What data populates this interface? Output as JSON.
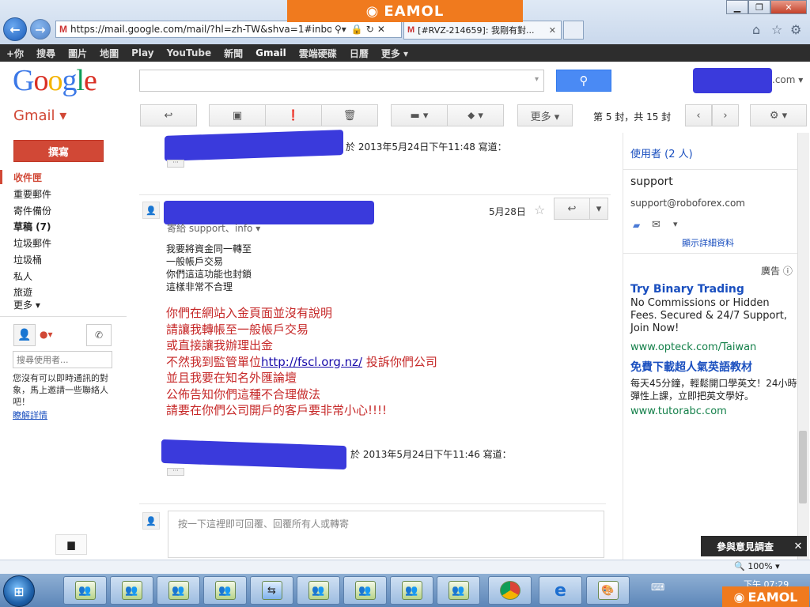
{
  "browser": {
    "url": "https://mail.google.com/mail/?hl=zh-TW&shva=1#inbox",
    "tab2_title": "[#RVZ-214659]: 我剛有對...",
    "watermark": "EAMOL",
    "zoom": "100%",
    "clock": "下午 07:29"
  },
  "gbar": [
    "+你",
    "搜尋",
    "圖片",
    "地圖",
    "Play",
    "YouTube",
    "新聞",
    "Gmail",
    "雲端硬碟",
    "日曆",
    "更多 ▾"
  ],
  "header": {
    "user_suffix": ".com ▾"
  },
  "toolbar": {
    "gmail_label": "Gmail ▾",
    "more_label": "更多 ▾",
    "page_info": "第 5 封，共 15 封"
  },
  "sidebar": {
    "compose": "撰寫",
    "items": [
      "收件匣",
      "重要郵件",
      "寄件備份",
      "草稿 (7)",
      "垃圾郵件",
      "垃圾桶",
      "私人",
      "旅遊",
      "更多 ▾"
    ],
    "chat_search_placeholder": "搜尋使用者...",
    "chat_empty": "您沒有可以即時通訊的對象，馬上邀請一些聯絡人吧！",
    "learn_more": "瞭解詳情"
  },
  "thread": {
    "quote1_date": "於 2013年5月24日下午11:48 寫道：",
    "msg_date": "5月28日",
    "msg_to": "寄給 support、info ▾",
    "small_lines": [
      "我要將資金同一轉至",
      "一般帳戶交易",
      "你們這這功能也封鎖",
      "這樣非常不合理"
    ],
    "red_lines": [
      "你們在網站入金頁面並沒有說明",
      "請讓我轉帳至一般帳戶交易",
      "或直接讓我辦理出金",
      "不然我到監管單位",
      "並且我要在知名外匯論壇",
      "公佈告知你們這種不合理做法",
      "請要在你們公司開戶的客戶要非常小心!!!!"
    ],
    "link": "http://fscl.org.nz/",
    "after_link": " 投訴你們公司",
    "quote2_date": "於 2013年5月24日下午11:46 寫道：",
    "reply_placeholder": "按一下這裡即可回覆、回覆所有人或轉寄"
  },
  "right": {
    "people": "使用者 (2 人)",
    "contact_name": "support",
    "contact_email": "support@roboforex.com",
    "show_details": "顯示詳細資料",
    "ads_label": "廣告 ⓘ",
    "ad1": {
      "title": "Try Binary Trading",
      "text": "No Commissions or Hidden Fees. Secured & 24/7 Support, Join Now!",
      "url": "www.opteck.com/Taiwan"
    },
    "ad2": {
      "title": "免費下載超人氣英語教材",
      "text": "每天45分鐘，輕鬆開口學英文！24小時彈性上課，立即把英文學好。",
      "url": "www.tutorabc.com"
    },
    "feedback": "參與意見調查"
  },
  "colors": {
    "gmail_red": "#d14836",
    "link_blue": "#1a4fbf",
    "ad_green": "#14804a",
    "message_red": "#c62828",
    "search_blue": "#4a8af4"
  }
}
